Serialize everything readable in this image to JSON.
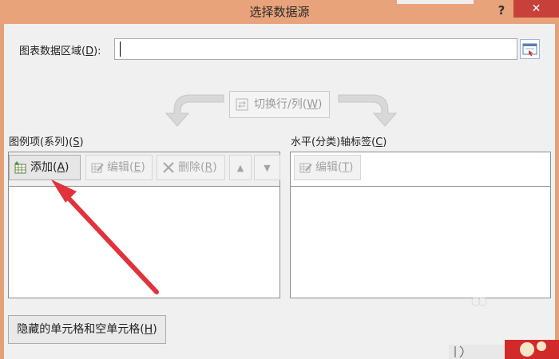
{
  "window": {
    "title": "选择数据源",
    "help_label": "?",
    "close_label": "✕"
  },
  "data_range": {
    "label": "图表数据区域(",
    "label_key": "D",
    "label_end": "):",
    "value": ""
  },
  "switch_button": {
    "label": "切换行/列(",
    "key": "W",
    "end": ")"
  },
  "series_panel": {
    "heading": "图例项(系列)(",
    "heading_key": "S",
    "heading_end": ")",
    "add_label": "添加(",
    "add_key": "A",
    "add_end": ")",
    "edit_label": "编辑(",
    "edit_key": "E",
    "edit_end": ")",
    "delete_label": "删除(",
    "delete_key": "R",
    "delete_end": ")",
    "up_symbol": "▲",
    "down_symbol": "▼",
    "items": []
  },
  "category_panel": {
    "heading": "水平(分类)轴标签(",
    "heading_key": "C",
    "heading_end": ")",
    "edit_label": "编辑(",
    "edit_key": "T",
    "edit_end": ")",
    "items": []
  },
  "hidden_cells_button": {
    "label": "隐藏的单元格和空单元格(",
    "key": "H",
    "end": ")"
  },
  "colors": {
    "titlebar": "#e8a37b",
    "close": "#c7413a",
    "annotation_arrow": "#e0333b"
  }
}
